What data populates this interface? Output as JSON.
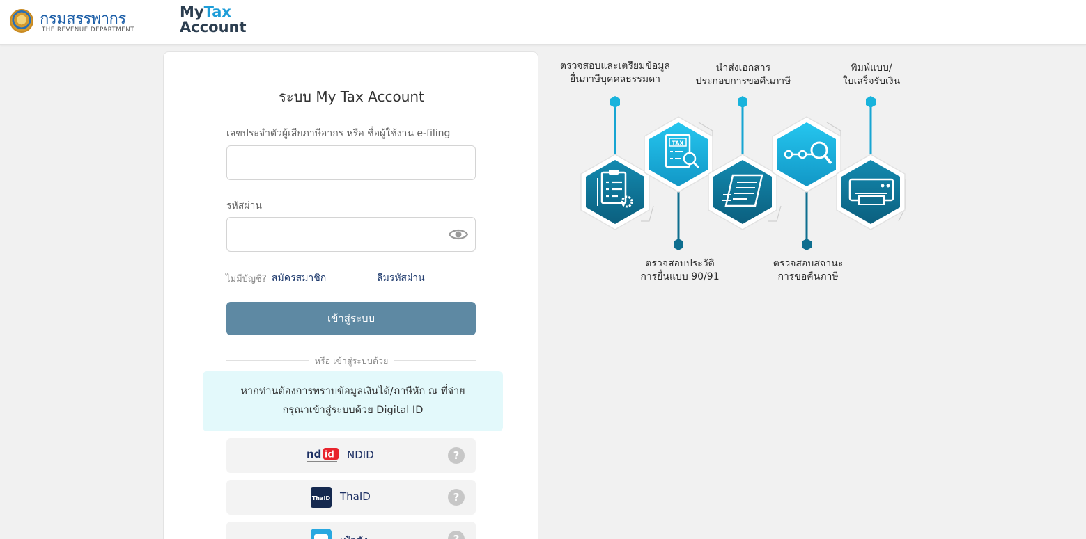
{
  "header": {
    "brand_th": "กรมสรรพากร",
    "brand_en": "THE REVENUE DEPARTMENT",
    "app_my": "My",
    "app_tax": "Tax",
    "app_account": "Account"
  },
  "login": {
    "title": "ระบบ My Tax Account",
    "username_label": "เลขประจำตัวผู้เสียภาษีอากร หรือ ชื่อผู้ใช้งาน e-filing",
    "username_value": "",
    "password_label": "รหัสผ่าน",
    "password_value": "",
    "no_account_text": "ไม่มีบัญชี?",
    "register_link": "สมัครสมาชิก",
    "forgot_link": "ลืมรหัสผ่าน",
    "login_button": "เข้าสู่ระบบ",
    "or_login_with": "หรือ เข้าสู่ระบบด้วย",
    "info_line1": "หากท่านต้องการทราบข้อมูลเงินได้/ภาษีหัก ณ ที่จ่าย",
    "info_line2": "กรุณาเข้าสู่ระบบด้วย Digital ID",
    "providers": [
      {
        "label": "NDID",
        "icon": "ndid-logo",
        "help": "?"
      },
      {
        "label": "ThaID",
        "icon": "thaid-logo",
        "help": "?"
      },
      {
        "label": "เป๋าตัง",
        "icon": "paotang-logo",
        "help": "?"
      }
    ]
  },
  "infographic": {
    "top_labels": [
      {
        "line1": "ตรวจสอบและเตรียมข้อมูล",
        "line2": "ยื่นภาษีบุคคลธรรมดา"
      },
      {
        "line1": "นำส่งเอกสาร",
        "line2": "ประกอบการขอคืนภาษี"
      },
      {
        "line1": "พิมพ์แบบ/",
        "line2": "ใบเสร็จรับเงิน"
      }
    ],
    "bottom_labels": [
      {
        "line1": "ตรวจสอบประวัติ",
        "line2": "การยื่นแบบ 90/91"
      },
      {
        "line1": "ตรวจสอบสถานะ",
        "line2": "การขอคืนภาษี"
      }
    ],
    "tax_badge": "TAX"
  },
  "colors": {
    "brand_blue": "#1d5fa8",
    "accent_cyan": "#1e9dd8",
    "login_button": "#5e89a3",
    "info_box": "#e3f9fb",
    "hex_dark": "#0e6e8f",
    "hex_light": "#18b3dc"
  }
}
